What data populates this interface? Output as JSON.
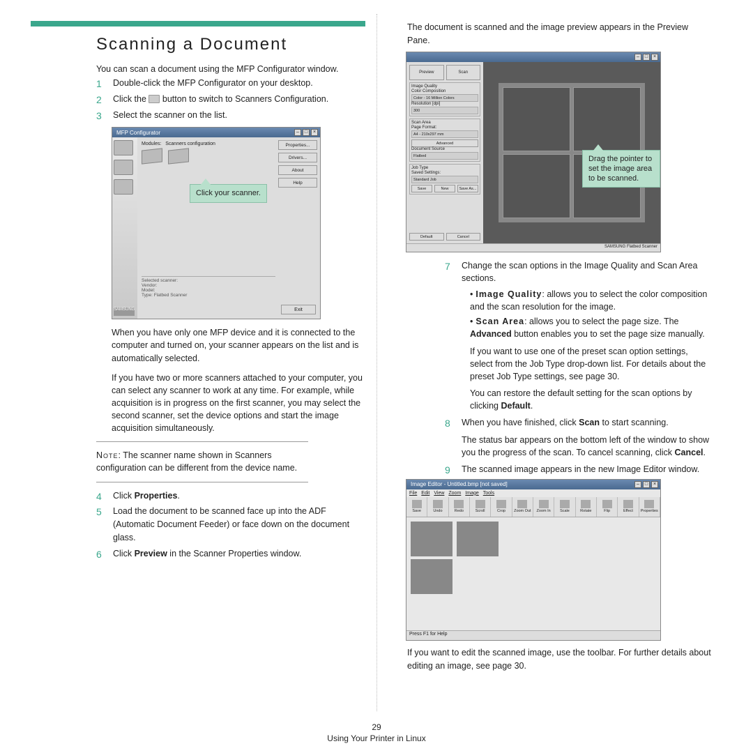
{
  "accent_color": "#3aa78c",
  "title": "Scanning a Document",
  "intro": "You can scan a document using the MFP Configurator window.",
  "steps_a": [
    {
      "n": "1",
      "text": "Double-click the MFP Configurator on your desktop."
    },
    {
      "n": "2",
      "pre": "Click the ",
      "post": " button to switch to Scanners Configuration."
    },
    {
      "n": "3",
      "text": "Select the scanner on the list."
    }
  ],
  "win1": {
    "title": "MFP Configurator",
    "cfg_label": "Modules:",
    "cfg_label2": "Scanners configuration",
    "btns": [
      "Properties...",
      "Drivers...",
      "About",
      "Help"
    ],
    "selected": "Selected scanner:\nVendor:\nModel:\nType: Flatbed Scanner",
    "exit": "Exit",
    "logo": "SAMSUNG"
  },
  "callout1": "Click your scanner.",
  "para1": "When you have only one MFP device and it is connected to the computer and turned on, your scanner appears on the list and is automatically selected.",
  "para2": "If you have two or more scanners attached to your computer, you can select any scanner to work at any time. For example, while acquisition is in progress on the first scanner, you may select the second scanner, set the device options and start the image acquisition simultaneously.",
  "note_lead": "Note",
  "note": ": The scanner name shown in Scanners configuration can be different from the device name.",
  "steps_b": [
    {
      "n": "4",
      "pre": "Click ",
      "bold": "Properties",
      "post": "."
    },
    {
      "n": "5",
      "text": "Load the document to be scanned face up into the ADF (Automatic Document Feeder) or face down on the document glass."
    },
    {
      "n": "6",
      "pre": "Click ",
      "bold": "Preview",
      "post": " in the Scanner Properties window."
    }
  ],
  "col2_top": "The document is scanned and the image preview appears in the Preview Pane.",
  "win2": {
    "p_btns_top": [
      "Preview",
      "Scan"
    ],
    "sec1_title": "Image Quality",
    "sec1_l1": "Color Composition",
    "sec1_v1": "Color - 16 Million Colors",
    "sec1_l2": "Resolution [dpi]",
    "sec1_v2": "300",
    "sec2_title": "Scan Area",
    "sec2_l1": "Page Format:",
    "sec2_v1": "A4 - 210x297 mm",
    "sec2_adv": "Advanced",
    "sec2_l2": "Document Source",
    "sec2_v2": "Flatbed",
    "sec3_title": "Job Type",
    "sec3_l1": "Saved Settings:",
    "sec3_v1": "Standard Job",
    "sec3_btns": [
      "Save",
      "New",
      "Save As..."
    ],
    "bottom_btns": [
      "Default",
      "Cancel"
    ],
    "status": "SAMSUNG Flatbed Scanner"
  },
  "callout2": "Drag the pointer to set the image area to be scanned.",
  "steps_c": [
    {
      "n": "7",
      "text": "Change the scan options in the Image Quality and Scan Area sections."
    }
  ],
  "sub": [
    {
      "lead": "Image Quality",
      "rest": ": allows you to select the color composition and the scan resolution for the image."
    },
    {
      "lead": "Scan Area",
      "rest": ": allows you to select the page size. The ",
      "bold": "Advanced",
      "rest2": " button enables you to set the page size manually."
    }
  ],
  "p2a": "If you want to use one of the preset scan option settings, select from the Job Type drop-down list. For details about the preset Job Type settings, see page 30.",
  "p2b_pre": "You can restore the default setting for the scan options by clicking ",
  "p2b_bold": "Default",
  "p2b_post": ".",
  "steps_d": [
    {
      "n": "8",
      "pre": "When you have finished, click ",
      "bold": "Scan",
      "post": " to start scanning."
    }
  ],
  "p3_pre": "The status bar appears on the bottom left of the window to show you the progress of the scan. To cancel scanning, click ",
  "p3_bold": "Cancel",
  "p3_post": ".",
  "steps_e": [
    {
      "n": "9",
      "text": "The scanned image appears in the new Image Editor window."
    }
  ],
  "win3": {
    "title": "Image Editor - Untitled.bmp [not saved]",
    "menus": [
      "File",
      "Edit",
      "View",
      "Zoom",
      "Image",
      "Tools"
    ],
    "tools": [
      "Save",
      "Undo",
      "Redo",
      "Scroll",
      "Crop",
      "Zoom Out",
      "Zoom In",
      "Scale",
      "Rotate",
      "Flip",
      "Effect",
      "Properties"
    ],
    "status": "Press F1 for Help"
  },
  "p4": "If you want to edit the scanned image, use the toolbar. For further details about editing an image, see page 30.",
  "footer_page": "29",
  "footer_text": "Using Your Printer in Linux"
}
